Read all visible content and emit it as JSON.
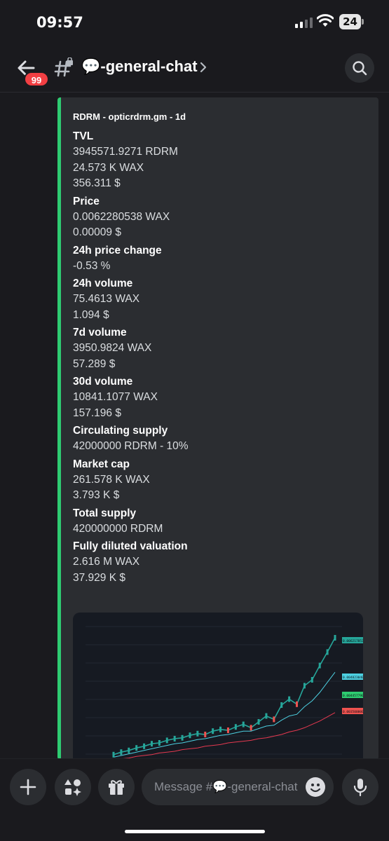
{
  "status": {
    "time": "09:57",
    "battery": "24"
  },
  "header": {
    "unread_count": "99",
    "channel_emoji": "💬",
    "channel_name": "-general-chat",
    "chevron": "›"
  },
  "embed": {
    "accent_color": "#2ecc71",
    "author": "RDRM - opticrdrm.gm - 1d",
    "fields": [
      {
        "name": "TVL",
        "values": [
          "3945571.9271 RDRM",
          "24.573 K WAX",
          "356.311 $"
        ]
      },
      {
        "name": "Price",
        "values": [
          "0.0062280538 WAX",
          "0.00009 $"
        ]
      },
      {
        "name": "24h price change",
        "values": [
          "-0.53 %"
        ]
      },
      {
        "name": "24h volume",
        "values": [
          "75.4613 WAX",
          "1.094 $"
        ]
      },
      {
        "name": "7d volume",
        "values": [
          "3950.9824 WAX",
          "57.289 $"
        ]
      },
      {
        "name": "30d volume",
        "values": [
          "10841.1077 WAX",
          "157.196 $"
        ]
      },
      {
        "name": "Circulating supply",
        "values": [
          "42000000 RDRM - 10%"
        ]
      },
      {
        "name": "Market cap",
        "values": [
          "261.578 K WAX",
          "3.793 K $"
        ]
      },
      {
        "name": "Total supply",
        "values": [
          "420000000 RDRM"
        ]
      },
      {
        "name": "Fully diluted valuation",
        "values": [
          "2.616 M WAX",
          "37.929 K $"
        ]
      }
    ]
  },
  "chart_data": {
    "type": "line",
    "title": "",
    "series": [
      {
        "values": [
          0.6,
          0.9,
          1.1,
          1.4,
          1.6,
          1.9,
          2.0,
          2.3,
          2.5,
          2.6,
          2.9,
          3.1,
          3.0,
          3.4,
          3.6,
          3.5,
          3.9,
          4.2,
          3.8,
          4.5,
          5.2,
          4.8,
          6.5,
          7.2,
          6.6,
          8.8,
          9.5,
          11.2,
          12.8,
          14.5
        ]
      },
      {
        "values": [
          0.3,
          0.5,
          0.7,
          0.9,
          1.1,
          1.3,
          1.5,
          1.7,
          1.9,
          2.0,
          2.2,
          2.4,
          2.5,
          2.7,
          2.9,
          3.0,
          3.2,
          3.4,
          3.4,
          3.7,
          4.0,
          4.1,
          4.7,
          5.2,
          5.4,
          6.3,
          7.0,
          8.0,
          9.2,
          10.4
        ]
      },
      {
        "values": [
          0.0,
          0.1,
          0.2,
          0.4,
          0.5,
          0.6,
          0.8,
          0.9,
          1.0,
          1.2,
          1.3,
          1.4,
          1.6,
          1.7,
          1.8,
          2.0,
          2.1,
          2.2,
          2.3,
          2.5,
          2.6,
          2.8,
          3.0,
          3.3,
          3.5,
          3.8,
          4.2,
          4.6,
          5.1,
          5.6
        ]
      }
    ],
    "series_colors": [
      "#26a69a",
      "#4dd0e1",
      "#e53950"
    ],
    "price_tags": [
      "0.0062178537",
      "0.0048230400",
      "0.0044577900",
      "0.0035000000"
    ],
    "price_tag_colors": [
      "#26a69a",
      "#4dd0e1",
      "#2ecc71",
      "#ef5350"
    ]
  },
  "composer": {
    "placeholder": "Message #💬-general-chat"
  },
  "icons": {
    "back": "arrow-left-icon",
    "channel": "hash-lock-icon",
    "search": "search-icon",
    "plus": "plus-icon",
    "apps": "apps-icon",
    "gift": "gift-icon",
    "emoji": "emoji-icon",
    "mic": "microphone-icon"
  }
}
